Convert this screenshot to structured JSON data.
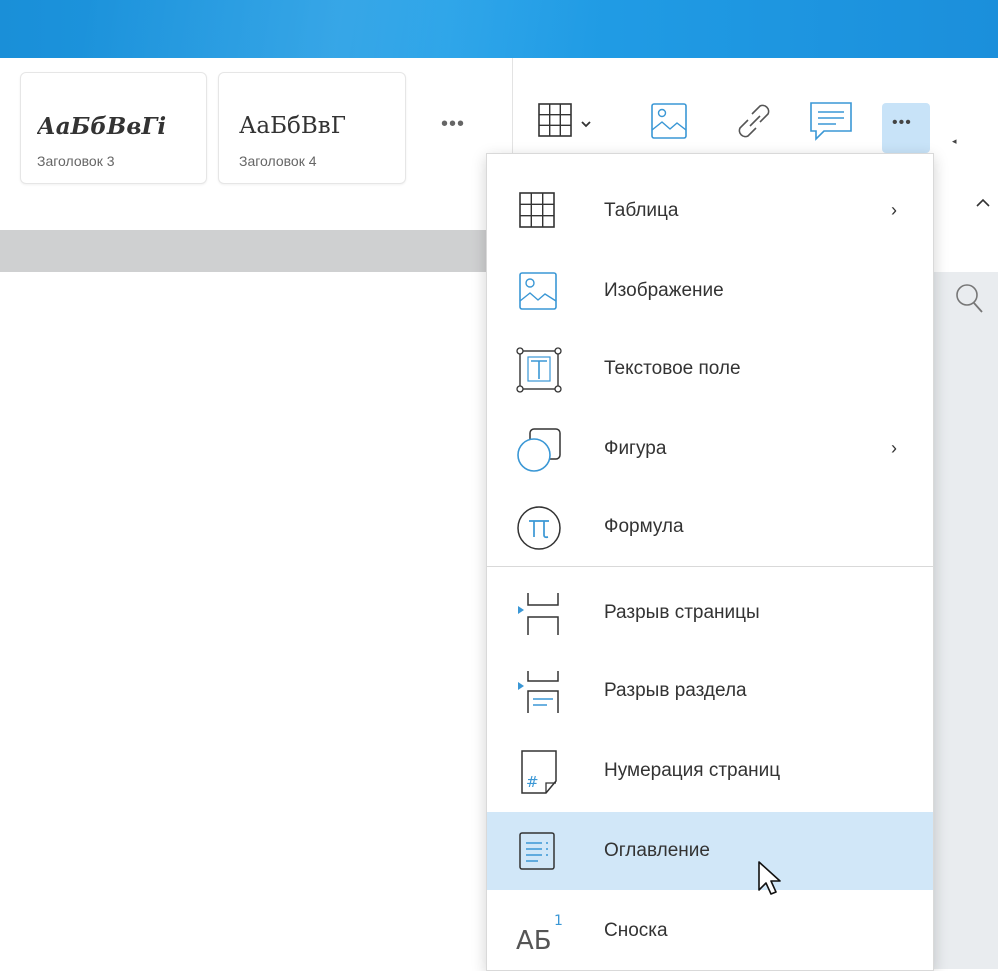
{
  "colors": {
    "accent": "#1e95dd",
    "icon_blue": "#3a97d5",
    "active_bg": "#d1e7f8"
  },
  "styles": [
    {
      "sample": "АаБбВвГі",
      "name": "Заголовок 3",
      "variant": "bold-italic"
    },
    {
      "sample": "АаБбВвГ",
      "name": "Заголовок 4",
      "variant": "regular"
    }
  ],
  "styles_more_label": "•••",
  "toolbar": {
    "buttons": [
      {
        "name": "table",
        "icon": "table-icon"
      },
      {
        "name": "image",
        "icon": "image-icon"
      },
      {
        "name": "link",
        "icon": "link-icon"
      },
      {
        "name": "comment",
        "icon": "comment-icon"
      },
      {
        "name": "more",
        "icon": "more-icon",
        "label": "•••"
      }
    ]
  },
  "menu": {
    "items": [
      {
        "label": "Таблица",
        "icon": "table-icon",
        "submenu": "›"
      },
      {
        "label": "Изображение",
        "icon": "image-icon"
      },
      {
        "label": "Текстовое поле",
        "icon": "text-box-icon"
      },
      {
        "label": "Фигура",
        "icon": "shape-icon",
        "submenu": "›"
      },
      {
        "label": "Формула",
        "icon": "formula-icon"
      },
      {
        "label": "Разрыв страницы",
        "icon": "page-break-icon"
      },
      {
        "label": "Разрыв раздела",
        "icon": "section-break-icon"
      },
      {
        "label": "Нумерация страниц",
        "icon": "page-numbering-icon"
      },
      {
        "label": "Оглавление",
        "icon": "table-of-contents-icon",
        "active": true
      },
      {
        "label": "Сноска",
        "icon": "footnote-icon"
      }
    ]
  }
}
